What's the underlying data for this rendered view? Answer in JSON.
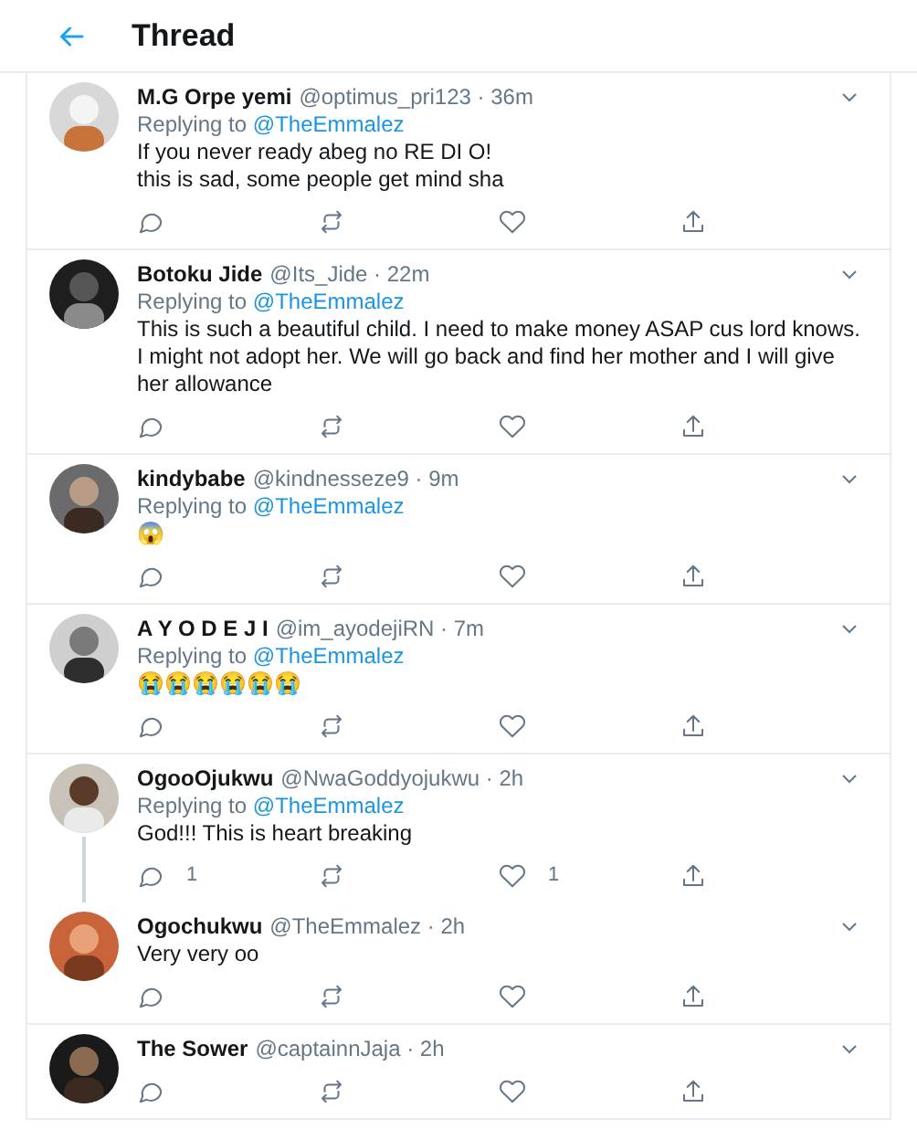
{
  "header": {
    "title": "Thread"
  },
  "tweets": [
    {
      "name": "M.G Orpe yemi",
      "meta": "@optimus_pri123 · 36m",
      "replying_label": "Replying to",
      "replying_to": "@TheEmmalez",
      "text": "If you never ready abeg no RE DI O!\nthis is sad, some people get mind sha",
      "thread_line": false
    },
    {
      "name": "Botoku Jide",
      "meta": "@Its_Jide · 22m",
      "replying_label": "Replying to",
      "replying_to": "@TheEmmalez",
      "text": "This is such a beautiful child. I need to make money ASAP cus lord knows. I might not adopt her. We will go back and find her mother and I will give her allowance",
      "thread_line": false
    },
    {
      "name": "kindybabe",
      "meta": "@kindnesseze9 · 9m",
      "replying_label": "Replying to",
      "replying_to": "@TheEmmalez",
      "text": "😱",
      "thread_line": false
    },
    {
      "name": "A Y O D E J I",
      "meta": "@im_ayodejiRN · 7m",
      "replying_label": "Replying to",
      "replying_to": "@TheEmmalez",
      "text": "😭😭😭😭😭😭",
      "thread_line": false
    },
    {
      "name": "OgooOjukwu",
      "meta": "@NwaGoddyojukwu · 2h",
      "replying_label": "Replying to",
      "replying_to": "@TheEmmalez",
      "text": "God!!! This is  heart breaking",
      "reply_count": "1",
      "like_count": "1",
      "thread_line": true
    },
    {
      "name": "Ogochukwu",
      "meta": "@TheEmmalez · 2h",
      "text": "Very very oo",
      "thread_line": false
    },
    {
      "name": "The Sower",
      "meta": "@captainnJaja · 2h",
      "thread_line": false
    }
  ]
}
